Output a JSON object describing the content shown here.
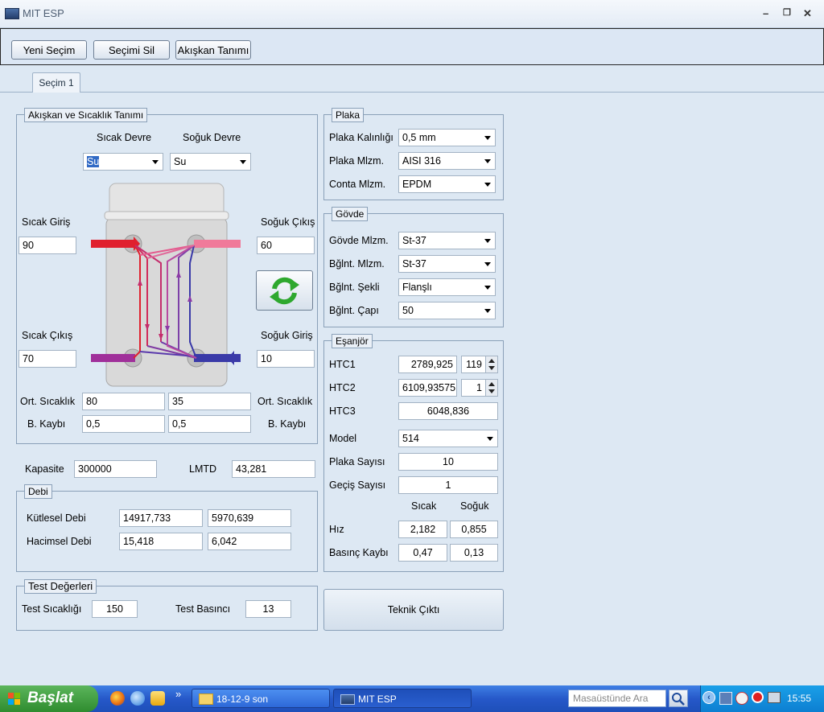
{
  "window": {
    "title": "MIT ESP",
    "min": "–",
    "max": "❐",
    "close": "✕"
  },
  "toolbar": {
    "new_selection": "Yeni Seçim",
    "delete_selection": "Seçimi Sil",
    "fluid_definition": "Akışkan Tanımı"
  },
  "tab": {
    "label": "Seçim 1"
  },
  "fluid": {
    "group_title": "Akışkan ve Sıcaklık Tanımı",
    "hot_circuit_label": "Sıcak Devre",
    "cold_circuit_label": "Soğuk Devre",
    "hot_fluid": "Su",
    "cold_fluid": "Su",
    "hot_in_label": "Sıcak Giriş",
    "hot_in": "90",
    "hot_out_label": "Sıcak Çıkış",
    "hot_out": "70",
    "cold_out_label": "Soğuk Çıkış",
    "cold_out": "60",
    "cold_in_label": "Soğuk Giriş",
    "cold_in": "10",
    "avg_temp_label": "Ort. Sıcaklık",
    "avg_hot": "80",
    "avg_cold": "35",
    "loss_label": "B. Kaybı",
    "loss_hot": "0,5",
    "loss_cold": "0,5"
  },
  "capacity": {
    "label": "Kapasite",
    "value": "300000"
  },
  "lmtd": {
    "label": "LMTD",
    "value": "43,281"
  },
  "flow": {
    "group_title": "Debi",
    "mass_label": "Kütlesel Debi",
    "mass_hot": "14917,733",
    "mass_cold": "5970,639",
    "volume_label": "Hacimsel Debi",
    "volume_hot": "15,418",
    "volume_cold": "6,042"
  },
  "test": {
    "group_title": "Test Değerleri",
    "temp_label": "Test Sıcaklığı",
    "temp": "150",
    "pressure_label": "Test Basıncı",
    "pressure": "13"
  },
  "plate": {
    "group_title": "Plaka",
    "thickness_label": "Plaka Kalınlığı",
    "thickness": "0,5 mm",
    "material_label": "Plaka Mlzm.",
    "material": "AISI 316",
    "gasket_label": "Conta Mlzm.",
    "gasket": "EPDM"
  },
  "body": {
    "group_title": "Gövde",
    "material_label": "Gövde Mlzm.",
    "material": "St-37",
    "conn_material_label": "Bğlnt. Mlzm.",
    "conn_material": "St-37",
    "conn_shape_label": "Bğlnt. Şekli",
    "conn_shape": "Flanşlı",
    "conn_dia_label": "Bğlnt. Çapı",
    "conn_dia": "50"
  },
  "exchanger": {
    "group_title": "Eşanjör",
    "htc1_label": "HTC1",
    "htc1": "2789,925",
    "htc1_spin": "119",
    "htc2_label": "HTC2",
    "htc2": "6109,93575",
    "htc2_spin": "1",
    "htc3_label": "HTC3",
    "htc3": "6048,836",
    "model_label": "Model",
    "model": "514",
    "plate_count_label": "Plaka Sayısı",
    "plate_count": "10",
    "pass_count_label": "Geçiş Sayısı",
    "pass_count": "1",
    "hot_col": "Sıcak",
    "cold_col": "Soğuk",
    "velocity_label": "Hız",
    "velocity_hot": "2,182",
    "velocity_cold": "0,855",
    "pressure_loss_label": "Basınç Kaybı",
    "pressure_loss_hot": "0,47",
    "pressure_loss_cold": "0,13"
  },
  "technical_output": {
    "label": "Teknik Çıktı"
  },
  "taskbar": {
    "start_label": "Başlat",
    "chevron": "»",
    "task1": "18-12-9 son",
    "task2": "MIT ESP",
    "search_placeholder": "Masaüstünde Ara",
    "clock": "15:55"
  },
  "colors": {
    "hot": "#e0202e",
    "cold": "#3a3aa8",
    "hot_out": "#a0309a",
    "cold_out": "#f07a9a"
  }
}
